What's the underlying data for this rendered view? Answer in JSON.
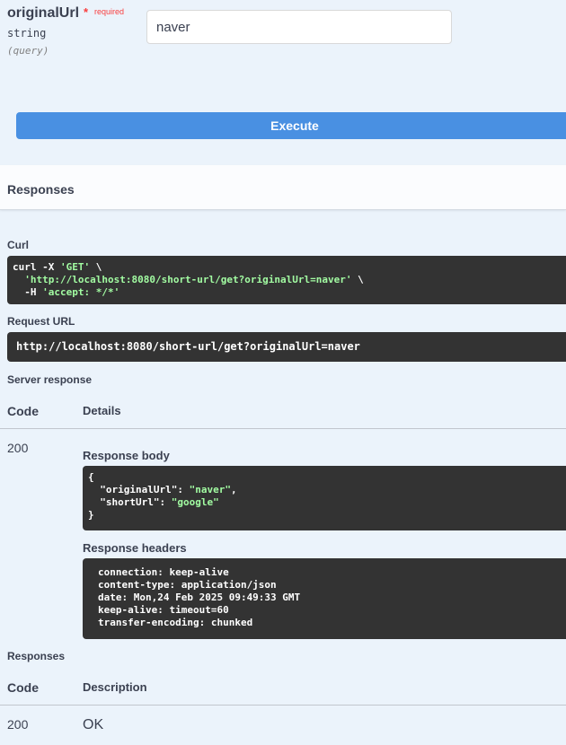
{
  "parameter": {
    "name": "originalUrl",
    "required_star": "*",
    "required_label": "required",
    "type": "string",
    "location": "(query)",
    "value": "naver"
  },
  "execute": {
    "label": "Execute"
  },
  "responses_section": {
    "title": "Responses"
  },
  "curl": {
    "label": "Curl",
    "cmd": "curl -X ",
    "method": "'GET'",
    "cont1": " \\",
    "url": "'http://localhost:8080/short-url/get?originalUrl=naver'",
    "cont2": " \\",
    "flag": "-H ",
    "header": "'accept: */*'"
  },
  "request_url": {
    "label": "Request URL",
    "value": "http://localhost:8080/short-url/get?originalUrl=naver"
  },
  "server_response": {
    "label": "Server response",
    "col_code": "Code",
    "col_details": "Details",
    "code": "200",
    "body_label": "Response body",
    "body": {
      "open": "{",
      "key1": "\"originalUrl\"",
      "sep1": ": ",
      "val1": "\"naver\"",
      "comma": ",",
      "key2": "\"shortUrl\"",
      "sep2": ": ",
      "val2": "\"google\"",
      "close": "}"
    },
    "headers_label": "Response headers",
    "headers": [
      "connection: keep-alive",
      "content-type: application/json",
      "date: Mon,24 Feb 2025 09:49:33 GMT",
      "keep-alive: timeout=60",
      "transfer-encoding: chunked"
    ]
  },
  "responses_table": {
    "label": "Responses",
    "col_code": "Code",
    "col_description": "Description",
    "rows": [
      {
        "code": "200",
        "description": "OK"
      }
    ]
  },
  "colors": {
    "execute": "#4990e2",
    "required": "#f93e3e",
    "code_bg": "#333333",
    "string_green": "#a2fca2"
  }
}
